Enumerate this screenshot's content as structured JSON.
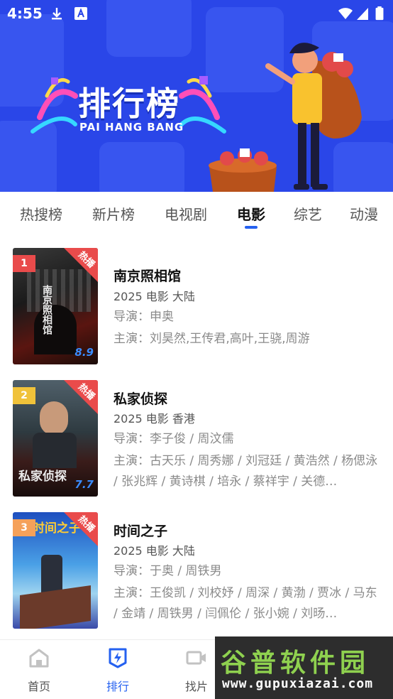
{
  "status_bar": {
    "time": "4:55"
  },
  "banner": {
    "title": "排行榜",
    "subtitle": "PAI HANG BANG"
  },
  "tabs": [
    {
      "label": "热搜榜"
    },
    {
      "label": "新片榜"
    },
    {
      "label": "电视剧"
    },
    {
      "label": "电影",
      "active": true
    },
    {
      "label": "综艺"
    },
    {
      "label": "动漫"
    }
  ],
  "items": [
    {
      "rank": "1",
      "rank_color": "#e94b4b",
      "hot_label": "热播",
      "poster_caption": "南京照相馆",
      "poster_score": "8.9",
      "title": "南京照相馆",
      "meta": "2025  电影  大陆",
      "director": "导演：申奥",
      "cast": "主演：刘昊然,王传君,高叶,王骁,周游"
    },
    {
      "rank": "2",
      "rank_color": "#f0c23a",
      "hot_label": "热播",
      "poster_caption": "私家侦探",
      "poster_score": "7.7",
      "title": "私家侦探",
      "meta": "2025  电影  香港",
      "director": "导演：李子俊 / 周汶儒",
      "cast": "主演：古天乐 / 周秀娜 / 刘冠廷 / 黄浩然 / 杨偲泳 / 张兆辉 / 黄诗棋 / 培永 / 蔡祥宇 / 关德…"
    },
    {
      "rank": "3",
      "rank_color": "#f5a15a",
      "hot_label": "热播",
      "poster_caption": "时间之子",
      "poster_score": "",
      "title": "时间之子",
      "meta": "2025  电影  大陆",
      "director": "导演：于奥 / 周铁男",
      "cast": "主演：王俊凯 / 刘校妤 / 周深 / 黄渤 / 贾冰 / 马东 / 金靖 / 周铁男 / 闫佩伦 / 张小婉 / 刘旸…"
    }
  ],
  "bottom_nav": [
    {
      "label": "首页",
      "icon": "home-icon"
    },
    {
      "label": "排行",
      "icon": "ranking-icon",
      "active": true
    },
    {
      "label": "找片",
      "icon": "video-icon"
    }
  ],
  "watermark": {
    "big": "谷普软件园",
    "small": "www.gupuxiazai.com"
  }
}
